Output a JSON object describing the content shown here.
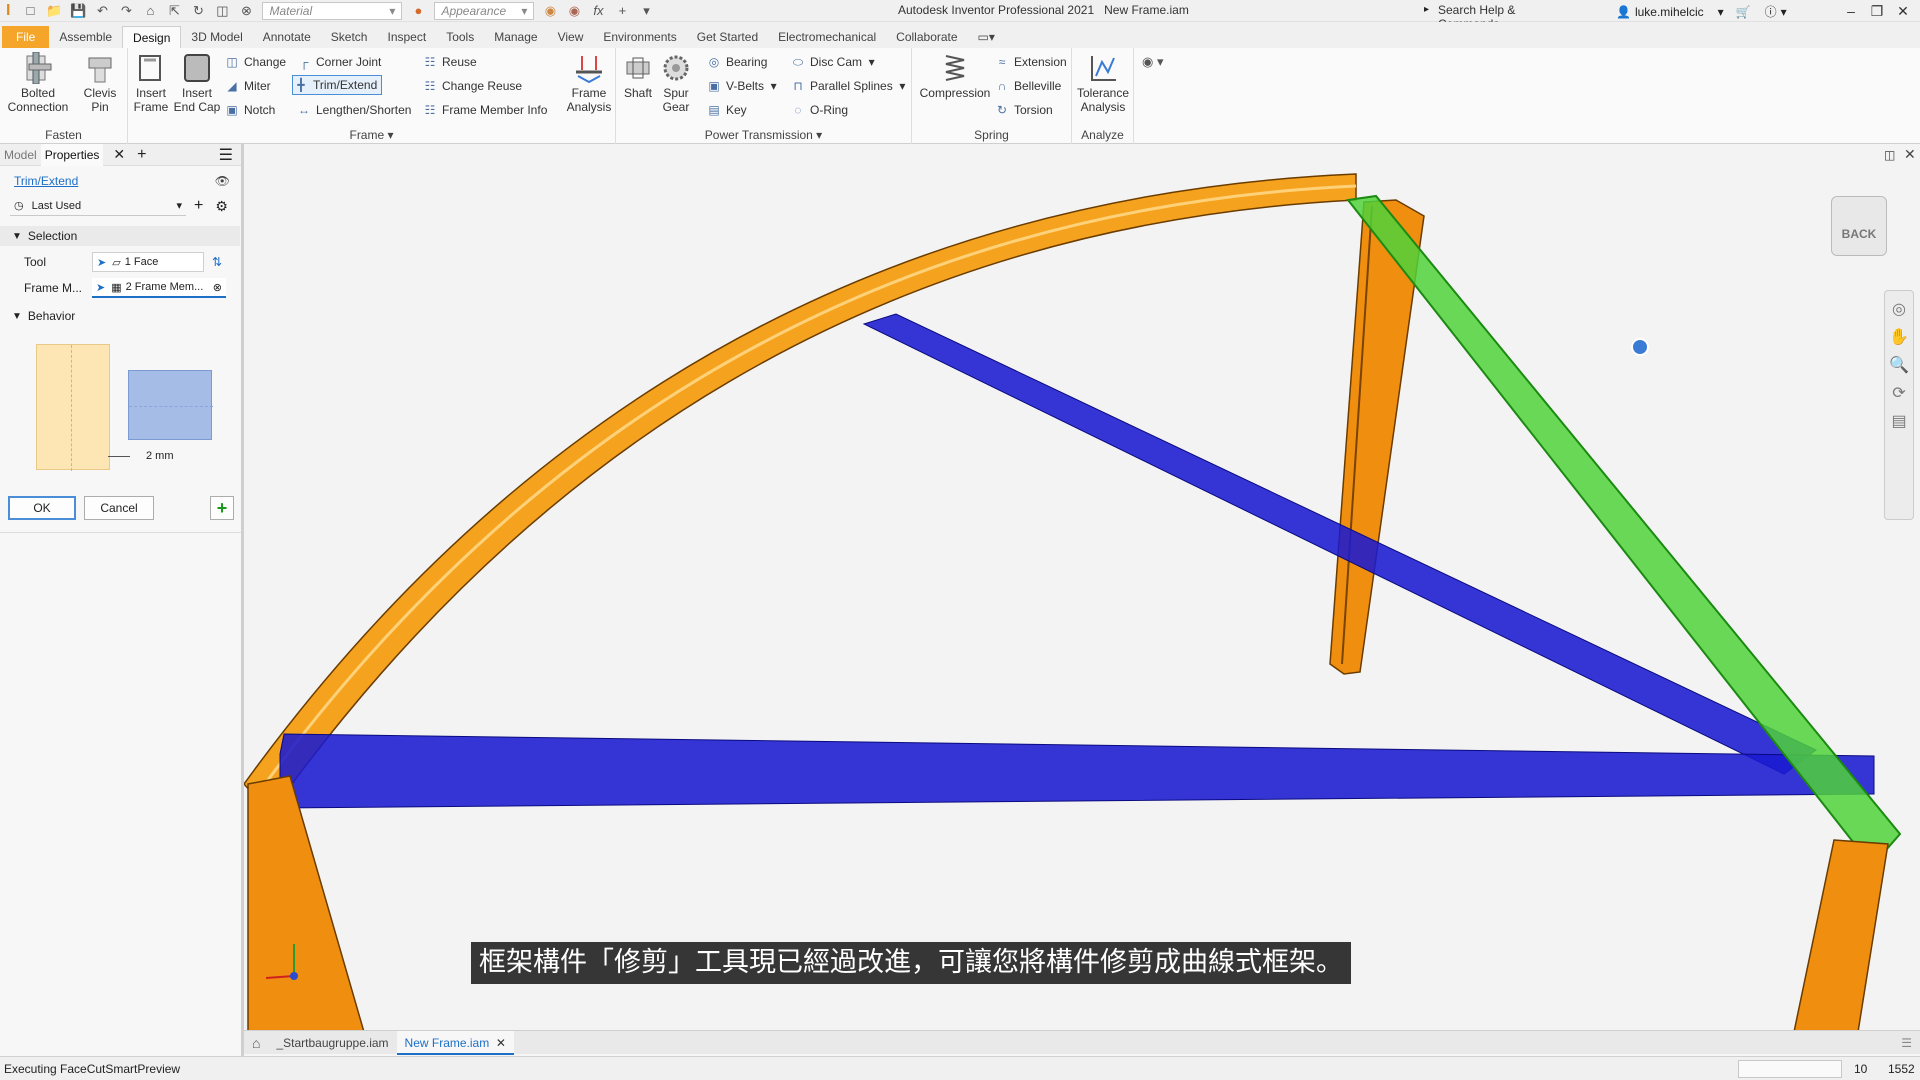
{
  "titlebar": {
    "material_placeholder": "Material",
    "appearance_placeholder": "Appearance",
    "app_name": "Autodesk Inventor Professional 2021",
    "document_name": "New Frame.iam",
    "search_placeholder": "Search Help & Commands...",
    "username": "luke.mihelcic"
  },
  "tabs": [
    "File",
    "Assemble",
    "Design",
    "3D Model",
    "Annotate",
    "Sketch",
    "Inspect",
    "Tools",
    "Manage",
    "View",
    "Environments",
    "Get Started",
    "Electromechanical",
    "Collaborate"
  ],
  "ribbon": {
    "fasten": {
      "label": "Fasten",
      "bolted_l1": "Bolted",
      "bolted_l2": "Connection",
      "clevis_l1": "Clevis",
      "clevis_l2": "Pin"
    },
    "frame": {
      "label": "Frame",
      "insert_frame_l1": "Insert",
      "insert_frame_l2": "Frame",
      "insert_endcap_l1": "Insert",
      "insert_endcap_l2": "End Cap",
      "change": "Change",
      "miter": "Miter",
      "notch": "Notch",
      "corner_joint": "Corner Joint",
      "trim_extend": "Trim/Extend",
      "lengthen_shorten": "Lengthen/Shorten",
      "reuse": "Reuse",
      "change_reuse": "Change Reuse",
      "frame_member_info": "Frame Member Info",
      "frame_analysis_l1": "Frame",
      "frame_analysis_l2": "Analysis"
    },
    "power": {
      "label": "Power Transmission",
      "shaft": "Shaft",
      "spur_l1": "Spur",
      "spur_l2": "Gear",
      "bearing": "Bearing",
      "vbelts": "V-Belts",
      "key": "Key",
      "disc_cam": "Disc Cam",
      "parallel_splines": "Parallel Splines",
      "oring": "O-Ring"
    },
    "spring": {
      "label": "Spring",
      "compression": "Compression",
      "extension": "Extension",
      "belleville": "Belleville",
      "torsion": "Torsion"
    },
    "analyze": {
      "label": "Analyze",
      "tol_l1": "Tolerance",
      "tol_l2": "Analysis"
    }
  },
  "panel": {
    "tab_model": "Model",
    "tab_properties": "Properties",
    "command_title": "Trim/Extend",
    "preset": "Last Used",
    "selection_header": "Selection",
    "tool_label": "Tool",
    "tool_value": "1 Face",
    "frame_members_label": "Frame M...",
    "frame_members_value": "2 Frame Mem...",
    "behavior_header": "Behavior",
    "offset_value": "2 mm",
    "ok": "OK",
    "cancel": "Cancel"
  },
  "viewcube": {
    "face": "BACK"
  },
  "doc_tabs": [
    "_Startbaugruppe.iam",
    "New Frame.iam"
  ],
  "subtitle": "框架構件「修剪」工具現已經過改進，可讓您將構件修剪成曲線式框架。",
  "status": {
    "message": "Executing FaceCutSmartPreview",
    "count1": "10",
    "count2": "1552"
  },
  "colors": {
    "file_tab": "#f4a52a",
    "frame_orange": "#f5a21e",
    "member_blue": "#1a1ad0",
    "selected_green": "#4fd23a",
    "link_blue": "#1e6fc8"
  }
}
